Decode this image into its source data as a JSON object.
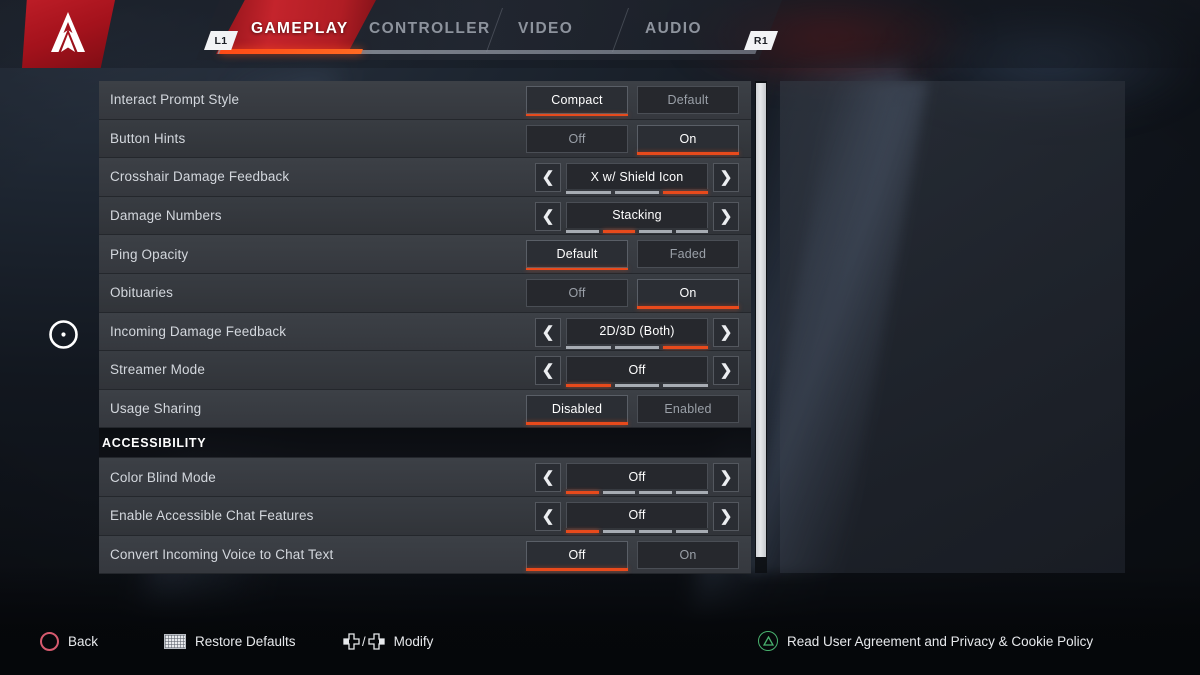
{
  "header": {
    "logo_icon": "apex-legends-logo",
    "bumper_left": "L1",
    "bumper_right": "R1",
    "tabs": [
      {
        "label": "GAMEPLAY",
        "active": true
      },
      {
        "label": "CONTROLLER",
        "active": false
      },
      {
        "label": "VIDEO",
        "active": false
      },
      {
        "label": "AUDIO",
        "active": false
      }
    ]
  },
  "settings": {
    "rows": [
      {
        "type": "toggle",
        "label": "Interact Prompt Style",
        "options": [
          "Compact",
          "Default"
        ],
        "selected": 0
      },
      {
        "type": "toggle",
        "label": "Button Hints",
        "options": [
          "Off",
          "On"
        ],
        "selected": 1
      },
      {
        "type": "stepper",
        "label": "Crosshair Damage Feedback",
        "value": "X w/ Shield Icon",
        "segments": 3,
        "active_segment": 2
      },
      {
        "type": "stepper",
        "label": "Damage Numbers",
        "value": "Stacking",
        "segments": 4,
        "active_segment": 1
      },
      {
        "type": "toggle",
        "label": "Ping Opacity",
        "options": [
          "Default",
          "Faded"
        ],
        "selected": 0
      },
      {
        "type": "toggle",
        "label": "Obituaries",
        "options": [
          "Off",
          "On"
        ],
        "selected": 1
      },
      {
        "type": "stepper",
        "label": "Incoming Damage Feedback",
        "value": "2D/3D (Both)",
        "segments": 3,
        "active_segment": 2
      },
      {
        "type": "stepper",
        "label": "Streamer Mode",
        "value": "Off",
        "segments": 3,
        "active_segment": 0
      },
      {
        "type": "toggle",
        "label": "Usage Sharing",
        "options": [
          "Disabled",
          "Enabled"
        ],
        "selected": 0
      },
      {
        "type": "section",
        "label": "ACCESSIBILITY"
      },
      {
        "type": "stepper",
        "label": "Color Blind Mode",
        "value": "Off",
        "segments": 4,
        "active_segment": 0
      },
      {
        "type": "stepper",
        "label": "Enable Accessible Chat Features",
        "value": "Off",
        "segments": 4,
        "active_segment": 0
      },
      {
        "type": "toggle",
        "label": "Convert Incoming Voice to Chat Text",
        "options": [
          "Off",
          "On"
        ],
        "selected": 0
      }
    ],
    "arrow_left_icon": "chevron-left-icon",
    "arrow_right_icon": "chevron-right-icon"
  },
  "cursor": {
    "icon": "reticle-cursor"
  },
  "footer": {
    "items": [
      {
        "label": "Back",
        "icon": "playstation-circle-button"
      },
      {
        "label": "Restore Defaults",
        "icon": "playstation-touchpad-button"
      },
      {
        "label": "Modify",
        "icon": "dpad-left-right-icon"
      }
    ],
    "right_item": {
      "label": "Read User Agreement and Privacy & Cookie Policy",
      "icon": "playstation-triangle-button"
    }
  },
  "colors": {
    "accent_red": "#e84a1c",
    "brand_red": "#c4242c",
    "panel_row": "#3c4046",
    "text_primary": "#ffffff",
    "text_muted": "#9aa0a8",
    "triangle_green": "#49b36f",
    "circle_pink": "#d65a6e"
  }
}
